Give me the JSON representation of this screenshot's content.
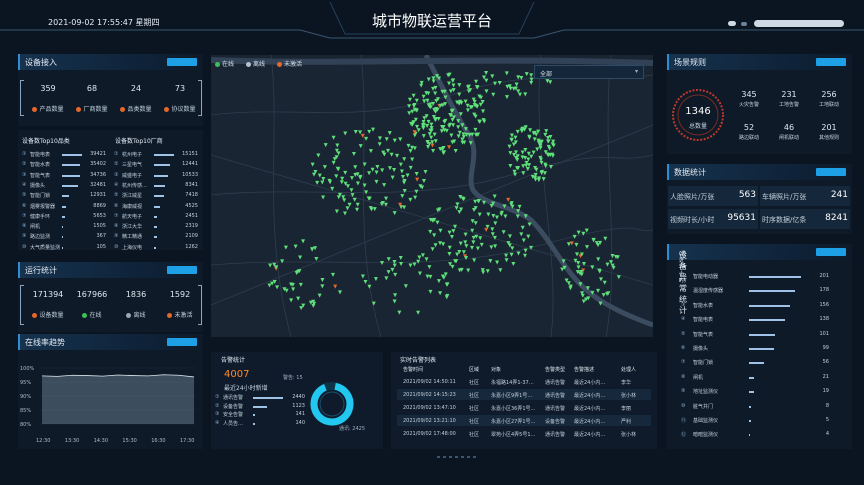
{
  "header": {
    "datetime": "2021-09-02 17:55:47 星期四",
    "title": "城市物联运营平台"
  },
  "device_access": {
    "title": "设备接入",
    "stats": [
      {
        "value": "359",
        "label": "产品数量",
        "color": "#e5672a"
      },
      {
        "value": "68",
        "label": "厂商数量",
        "color": "#e5672a"
      },
      {
        "value": "24",
        "label": "品类数量",
        "color": "#e5672a"
      },
      {
        "value": "73",
        "label": "协议数量",
        "color": "#e5672a"
      }
    ]
  },
  "top10_category": {
    "title": "设备数Top10品类",
    "items": [
      {
        "rank": "①",
        "name": "智能电表",
        "value": "39421"
      },
      {
        "rank": "②",
        "name": "智能水表",
        "value": "35402"
      },
      {
        "rank": "③",
        "name": "智能气表",
        "value": "34736"
      },
      {
        "rank": "④",
        "name": "摄像头",
        "value": "32481"
      },
      {
        "rank": "⑤",
        "name": "智能门锁",
        "value": "12931"
      },
      {
        "rank": "⑥",
        "name": "烟雾报警器",
        "value": "8869"
      },
      {
        "rank": "⑦",
        "name": "健康手环",
        "value": "5653"
      },
      {
        "rank": "⑧",
        "name": "闸机",
        "value": "1505"
      },
      {
        "rank": "⑨",
        "name": "路边监测",
        "value": "367"
      },
      {
        "rank": "⑩",
        "name": "大气质量监测",
        "value": "105"
      }
    ],
    "bar_fraction": [
      1.0,
      0.9,
      0.88,
      0.82,
      0.33,
      0.22,
      0.14,
      0.05,
      0.02,
      0.01
    ]
  },
  "top10_vendor": {
    "title": "设备数Top10厂商",
    "items": [
      {
        "rank": "①",
        "name": "杭州电子",
        "value": "15151"
      },
      {
        "rank": "②",
        "name": "三星电气",
        "value": "12441"
      },
      {
        "rank": "③",
        "name": "威盛电子",
        "value": "10533"
      },
      {
        "rank": "④",
        "name": "杭州传感…",
        "value": "8341"
      },
      {
        "rank": "⑤",
        "name": "浙江威星",
        "value": "7418"
      },
      {
        "rank": "⑥",
        "name": "海康威视",
        "value": "4525"
      },
      {
        "rank": "⑦",
        "name": "航天电子",
        "value": "2451"
      },
      {
        "rank": "⑧",
        "name": "浙江大华",
        "value": "2319"
      },
      {
        "rank": "⑨",
        "name": "精工精通",
        "value": "2109"
      },
      {
        "rank": "⑩",
        "name": "上海仪电",
        "value": "1262"
      }
    ],
    "bar_fraction": [
      1.0,
      0.82,
      0.7,
      0.55,
      0.49,
      0.3,
      0.16,
      0.15,
      0.14,
      0.08
    ]
  },
  "running_stats": {
    "title": "运行统计",
    "stats": [
      {
        "value": "171394",
        "label": "设备数量",
        "color": "#e5672a"
      },
      {
        "value": "167966",
        "label": "在线",
        "color": "#3fbf5a"
      },
      {
        "value": "1836",
        "label": "离线",
        "color": "#9aa7b4"
      },
      {
        "value": "1592",
        "label": "未激活",
        "color": "#e5672a"
      }
    ]
  },
  "online_trend": {
    "title": "在线率趋势",
    "chart_data": {
      "type": "area",
      "x": [
        "12:30",
        "13:30",
        "14:30",
        "15:30",
        "16:30",
        "17:30"
      ],
      "y_ticks": [
        "100%",
        "95%",
        "90%",
        "85%",
        "80%"
      ],
      "ylim": [
        80,
        100
      ],
      "values": [
        97.2,
        97.0,
        97.4,
        97.3,
        97.1,
        97.5,
        97.3,
        97.2,
        97.6,
        97.4,
        96.8
      ]
    }
  },
  "map": {
    "legend": [
      {
        "label": "在线",
        "color": "#3fbf5a"
      },
      {
        "label": "离线",
        "color": "#b7c2cc"
      },
      {
        "label": "未激活",
        "color": "#e5672a"
      }
    ],
    "filter": "全部"
  },
  "alarm_stats": {
    "title": "告警统计",
    "count": "4007",
    "sub": "最近24小时新增",
    "items": [
      {
        "rank": "①",
        "name": "通讯告警",
        "value": "2440"
      },
      {
        "rank": "②",
        "name": "设备告警",
        "value": "1123"
      },
      {
        "rank": "③",
        "name": "安全告警",
        "value": "141"
      },
      {
        "rank": "④",
        "name": "人员告…",
        "value": "140"
      }
    ],
    "bar_fraction": [
      1.0,
      0.46,
      0.06,
      0.06
    ],
    "ring_labels": {
      "top": "警告: 15",
      "right": "通讯: 2425"
    }
  },
  "realtime_alarms": {
    "title": "实时告警列表",
    "columns": [
      "告警时间",
      "区域",
      "对象",
      "告警类型",
      "告警描述",
      "处理人"
    ],
    "rows": [
      [
        "2021/09/02 14:50:11",
        "社区",
        "永福路14弄1-37…",
        "通讯告警",
        "最近24小内…",
        "李华"
      ],
      [
        "2021/09/02 14:15:23",
        "社区",
        "永嘉小区9弄1号…",
        "通讯告警",
        "最近24小内…",
        "张小林"
      ],
      [
        "2021/09/02 13:47:10",
        "社区",
        "永嘉小区36弄1号…",
        "通讯告警",
        "最近24小内…",
        "李丽"
      ],
      [
        "2021/09/02 13:21:10",
        "社区",
        "永嘉小区27弄1号…",
        "设备告警",
        "最近24小内…",
        "严利"
      ],
      [
        "2021/09/02 17:48:00",
        "社区",
        "翠苑小区4弄5号1…",
        "通讯告警",
        "最近24小内…",
        "张小林"
      ]
    ]
  },
  "scene_rules": {
    "title": "场景规则",
    "total": "1346",
    "total_label": "总数量",
    "stats": [
      {
        "value": "345",
        "label": "火灾告警"
      },
      {
        "value": "231",
        "label": "工地告警"
      },
      {
        "value": "256",
        "label": "工地联动"
      },
      {
        "value": "52",
        "label": "路边联动"
      },
      {
        "value": "46",
        "label": "闸机联动"
      },
      {
        "value": "201",
        "label": "其他规则"
      }
    ]
  },
  "data_stats": {
    "title": "数据统计",
    "items": [
      {
        "label": "人脸照片/万张",
        "value": "563"
      },
      {
        "label": "车辆照片/万张",
        "value": "241"
      },
      {
        "label": "视频时长/小时",
        "value": "95631"
      },
      {
        "label": "时序数据/亿条",
        "value": "8241"
      }
    ]
  },
  "abnormal_stats": {
    "title": "设备异常统计",
    "subtitle": "(最近24小时)",
    "items": [
      {
        "rank": "①",
        "name": "智能电动器",
        "value": "201"
      },
      {
        "rank": "②",
        "name": "温湿度传感器",
        "value": "178"
      },
      {
        "rank": "③",
        "name": "智能水表",
        "value": "156"
      },
      {
        "rank": "④",
        "name": "智能电表",
        "value": "138"
      },
      {
        "rank": "⑤",
        "name": "智能气表",
        "value": "101"
      },
      {
        "rank": "⑥",
        "name": "摄像头",
        "value": "99"
      },
      {
        "rank": "⑦",
        "name": "智能门锁",
        "value": "56"
      },
      {
        "rank": "⑧",
        "name": "闸机",
        "value": "21"
      },
      {
        "rank": "⑨",
        "name": "地址监测仪",
        "value": "19"
      },
      {
        "rank": "⑩",
        "name": "脏气井门",
        "value": "8"
      },
      {
        "rank": "⑪",
        "name": "基础监测仪",
        "value": "5"
      },
      {
        "rank": "⑫",
        "name": "暗暗监测仪",
        "value": "4"
      }
    ],
    "bar_fraction": [
      1.0,
      0.88,
      0.78,
      0.69,
      0.5,
      0.49,
      0.28,
      0.1,
      0.09,
      0.04,
      0.03,
      0.02
    ]
  }
}
